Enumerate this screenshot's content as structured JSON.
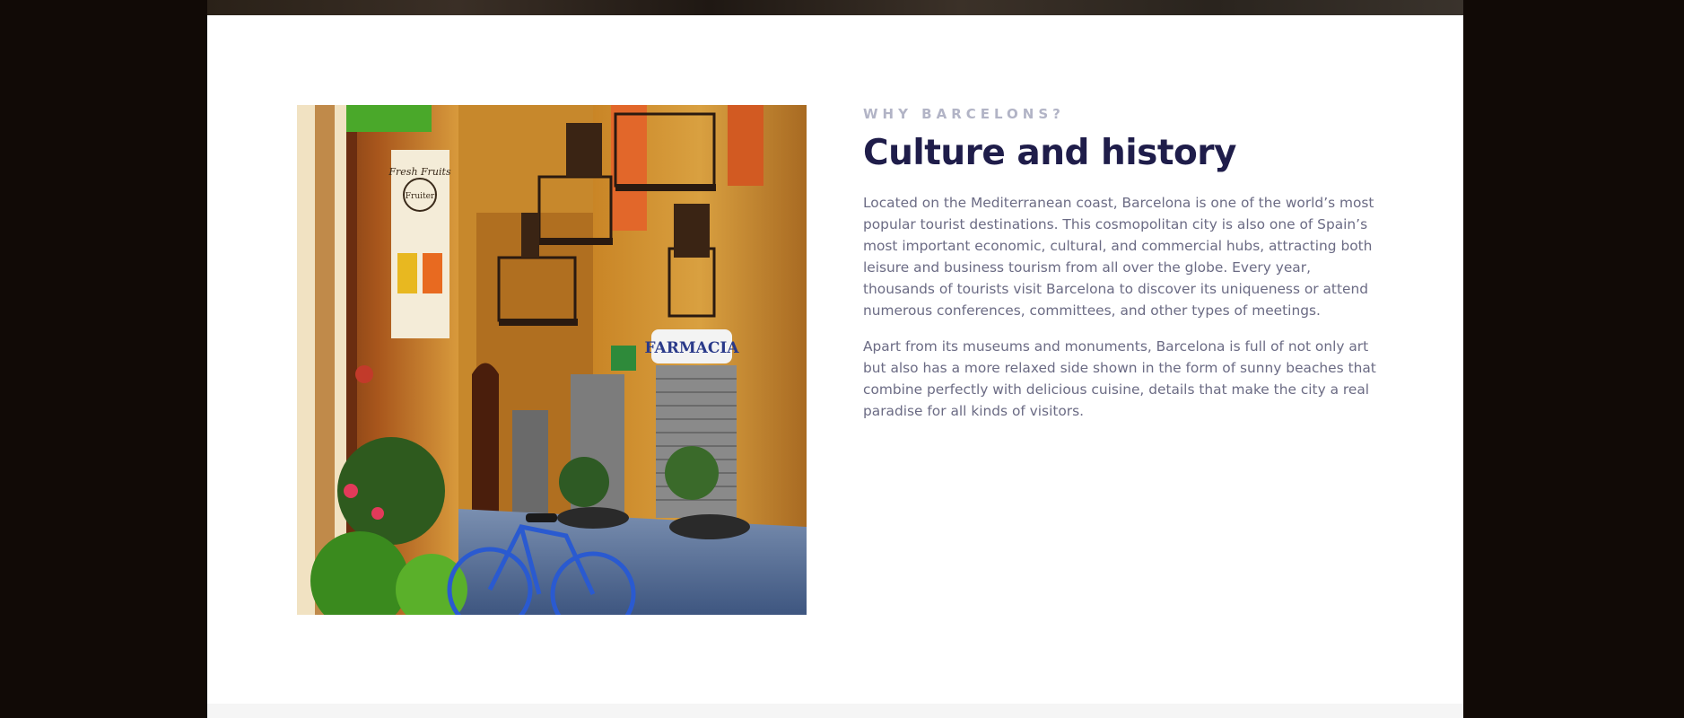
{
  "section": {
    "eyebrow": "WHY BARCELONS?",
    "title": "Culture and history",
    "paragraphs": [
      "Located on the Mediterranean coast, Barcelona is one of the world’s most popular tourist destinations. This cosmopolitan city is also one of Spain’s most important economic, cultural, and commercial hubs, attracting both leisure and business tourism from all over the globe. Every year, thousands of tourists visit Barcelona to discover its uniqueness or attend numerous conferences, committees, and other types of meetings.",
      "Apart from its museums and monuments, Barcelona is full of not only art but also has a more relaxed side shown in the form of sunny beaches that combine perfectly with delicious cuisine, details that make the city a real paradise for all kinds of visitors."
    ]
  },
  "photo": {
    "shop_sign": "FARMACIA",
    "banner_lines": [
      "Fresh Fruits",
      "Fruiter"
    ]
  },
  "colors": {
    "page_background": "#110a06",
    "card_background": "#ffffff",
    "eyebrow": "#b2b4c6",
    "title": "#1f1d4a",
    "body_text": "#6b6b84"
  }
}
